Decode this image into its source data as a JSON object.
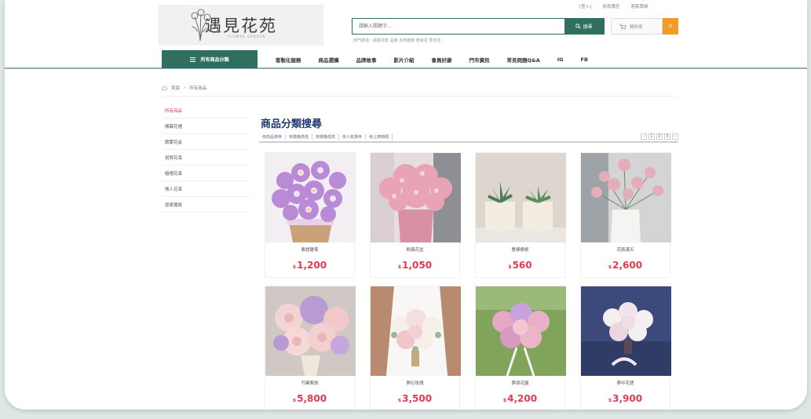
{
  "header": {
    "logo_text": "遇見花苑",
    "logo_sub": "FLOWER GARDEN",
    "top_links": [
      "[登入]",
      "會員專區",
      "客服專線"
    ],
    "search_placeholder": "請輸入關鍵字...",
    "search_button": "搜尋",
    "hot_keywords": "熱門搜尋：開幕花籃 盆栽 多肉植物 乾燥花 香皂花",
    "cart_label": "購物車",
    "cart_count": "0"
  },
  "nav": {
    "all_categories": "所有商品分類",
    "items": [
      "客製化服務",
      "商品選購",
      "品牌故事",
      "影片介紹",
      "會員好康",
      "門市資訊",
      "常見問題Q&A",
      "IG",
      "FB"
    ]
  },
  "breadcrumb": [
    "首頁",
    "所有商品"
  ],
  "sidebar": {
    "items": [
      "所有商品",
      "開幕花禮",
      "節慶花盒",
      "祝賀花束",
      "婚禮花束",
      "情人花束",
      "居家擺設"
    ]
  },
  "main": {
    "title": "商品分類搜尋",
    "sort_options": [
      "依商品排序",
      "依價格高低",
      "依價格低高",
      "依人氣排序",
      "依上架時間"
    ],
    "pages": [
      "‹",
      "1",
      "2",
      "3",
      "›"
    ]
  },
  "products": [
    {
      "name": "紫語雛菊",
      "currency": "$",
      "price": "1,200"
    },
    {
      "name": "粉霧花盆",
      "currency": "$",
      "price": "1,050"
    },
    {
      "name": "雙棲療癒",
      "currency": "$",
      "price": "560"
    },
    {
      "name": "花瓶滿天",
      "currency": "$",
      "price": "2,600"
    },
    {
      "name": "芍藥紫戀",
      "currency": "$",
      "price": "5,800"
    },
    {
      "name": "夢幻玫瑰",
      "currency": "$",
      "price": "3,500"
    },
    {
      "name": "夢境花園",
      "currency": "$",
      "price": "4,200"
    },
    {
      "name": "夢中花語",
      "currency": "$",
      "price": "3,900"
    }
  ],
  "colors": {
    "brand_green": "#2f6e61",
    "price_red": "#e8384f",
    "cart_orange": "#f39a28",
    "title_navy": "#1f3b6e"
  }
}
